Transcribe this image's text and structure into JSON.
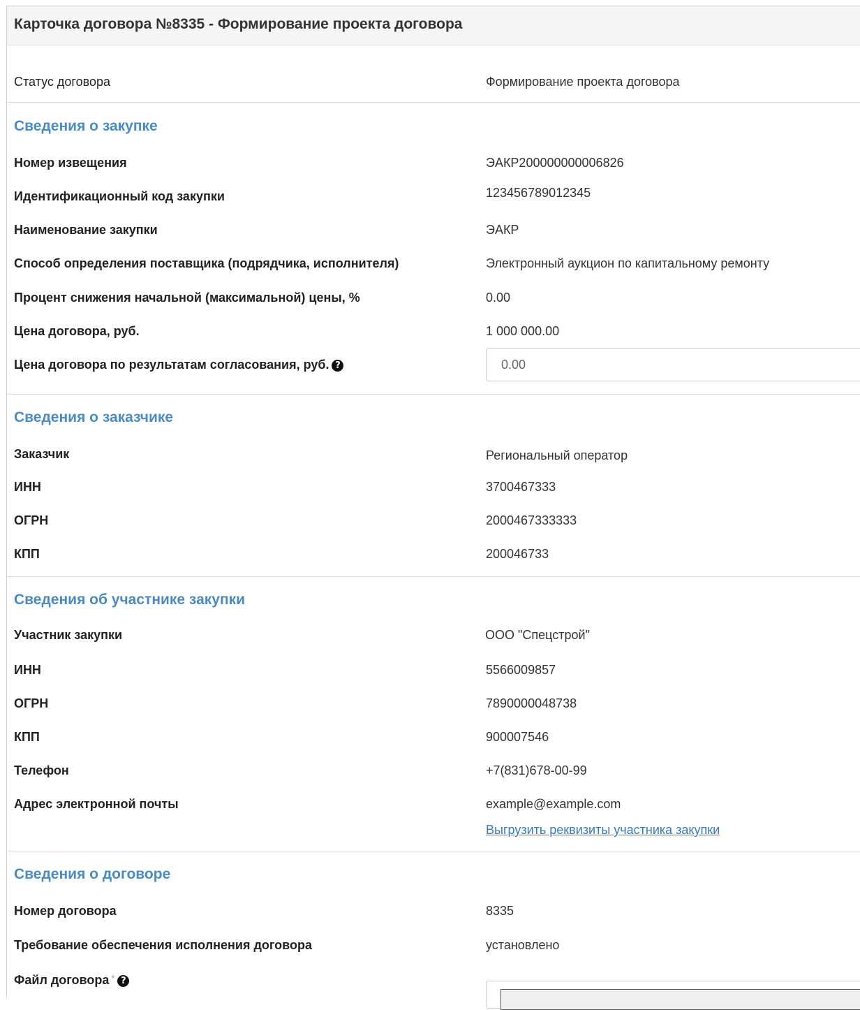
{
  "header": {
    "title": "Карточка договора №8335 - Формирование проекта договора"
  },
  "status": {
    "label": "Статус договора",
    "value": "Формирование проекта договора"
  },
  "purchase": {
    "title": "Сведения о закупке",
    "notice_label": "Номер извещения",
    "notice_value": "ЭАКР200000000006826",
    "code_label": "Идентификационный код закупки",
    "code_value": "123456789012345",
    "name_label": "Наименование закупки",
    "name_value": "ЭАКР",
    "method_label": "Способ определения поставщика (подрядчика, исполнителя)",
    "method_value": "Электронный аукцион по капитальному ремонту",
    "discount_label": "Процент снижения начальной (максимальной) цены, %",
    "discount_value": "0.00",
    "price_label": "Цена договора, руб.",
    "price_value": "1 000 000.00",
    "agreed_price_label": "Цена договора по результатам согласования, руб.",
    "agreed_price_value": "0.00"
  },
  "customer": {
    "title": "Сведения о заказчике",
    "customer_label": "Заказчик",
    "customer_value": "Региональный оператор",
    "inn_label": "ИНН",
    "inn_value": "3700467333",
    "ogrn_label": "ОГРН",
    "ogrn_value": "2000467333333",
    "kpp_label": "КПП",
    "kpp_value": "200046733"
  },
  "participant": {
    "title": "Сведения об участнике закупки",
    "participant_label": "Участник закупки",
    "participant_value": "ООО \"Спецстрой\"",
    "inn_label": "ИНН",
    "inn_value": "5566009857",
    "ogrn_label": "ОГРН",
    "ogrn_value": "7890000048738",
    "kpp_label": "КПП",
    "kpp_value": "900007546",
    "phone_label": "Телефон",
    "phone_value": "+7(831)678-00-99",
    "email_label": "Адрес электронной почты",
    "email_value": "example@example.com",
    "export_link": "Выгрузить реквизиты участника закупки"
  },
  "contract": {
    "title": "Сведения о договоре",
    "number_label": "Номер договора",
    "number_value": "8335",
    "security_label": "Требование обеспечения исполнения договора",
    "security_value": "установлено",
    "file_label": "Файл договора",
    "required_mark": "*"
  },
  "icons": {
    "help": "question-circle-icon"
  }
}
